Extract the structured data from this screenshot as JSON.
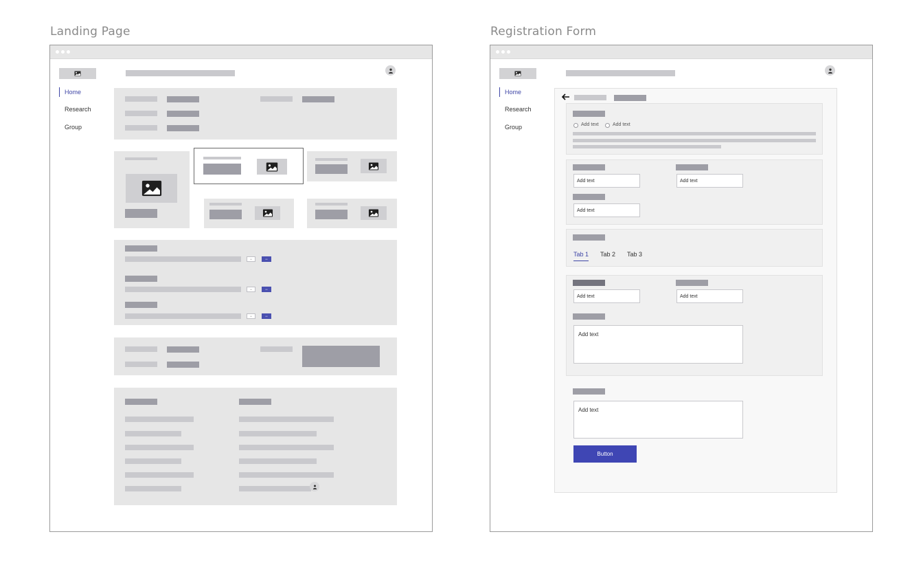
{
  "titles": {
    "landing": "Landing Page",
    "registration": "Registration Form"
  },
  "nav": {
    "items": [
      "Home",
      "Research",
      "Group"
    ],
    "active": "Home"
  },
  "list_buttons": {
    "secondary": "•••",
    "primary": "•••"
  },
  "form": {
    "radio_1": "Add text",
    "radio_2": "Add text",
    "field_placeholder": "Add text",
    "textarea_placeholder": "Add text",
    "tabs": [
      "Tab 1",
      "Tab 2",
      "Tab 3"
    ],
    "active_tab": "Tab 1",
    "button": "Button"
  },
  "colors": {
    "accent": "#3f46a6",
    "button": "#3f46b4",
    "panel": "#e6e6e6",
    "placeholder_light": "#c9c9cd",
    "placeholder_dark": "#9e9ea6"
  },
  "icons": {
    "logo": "image-icon",
    "avatar": "user-icon",
    "back": "arrow-left-icon"
  }
}
